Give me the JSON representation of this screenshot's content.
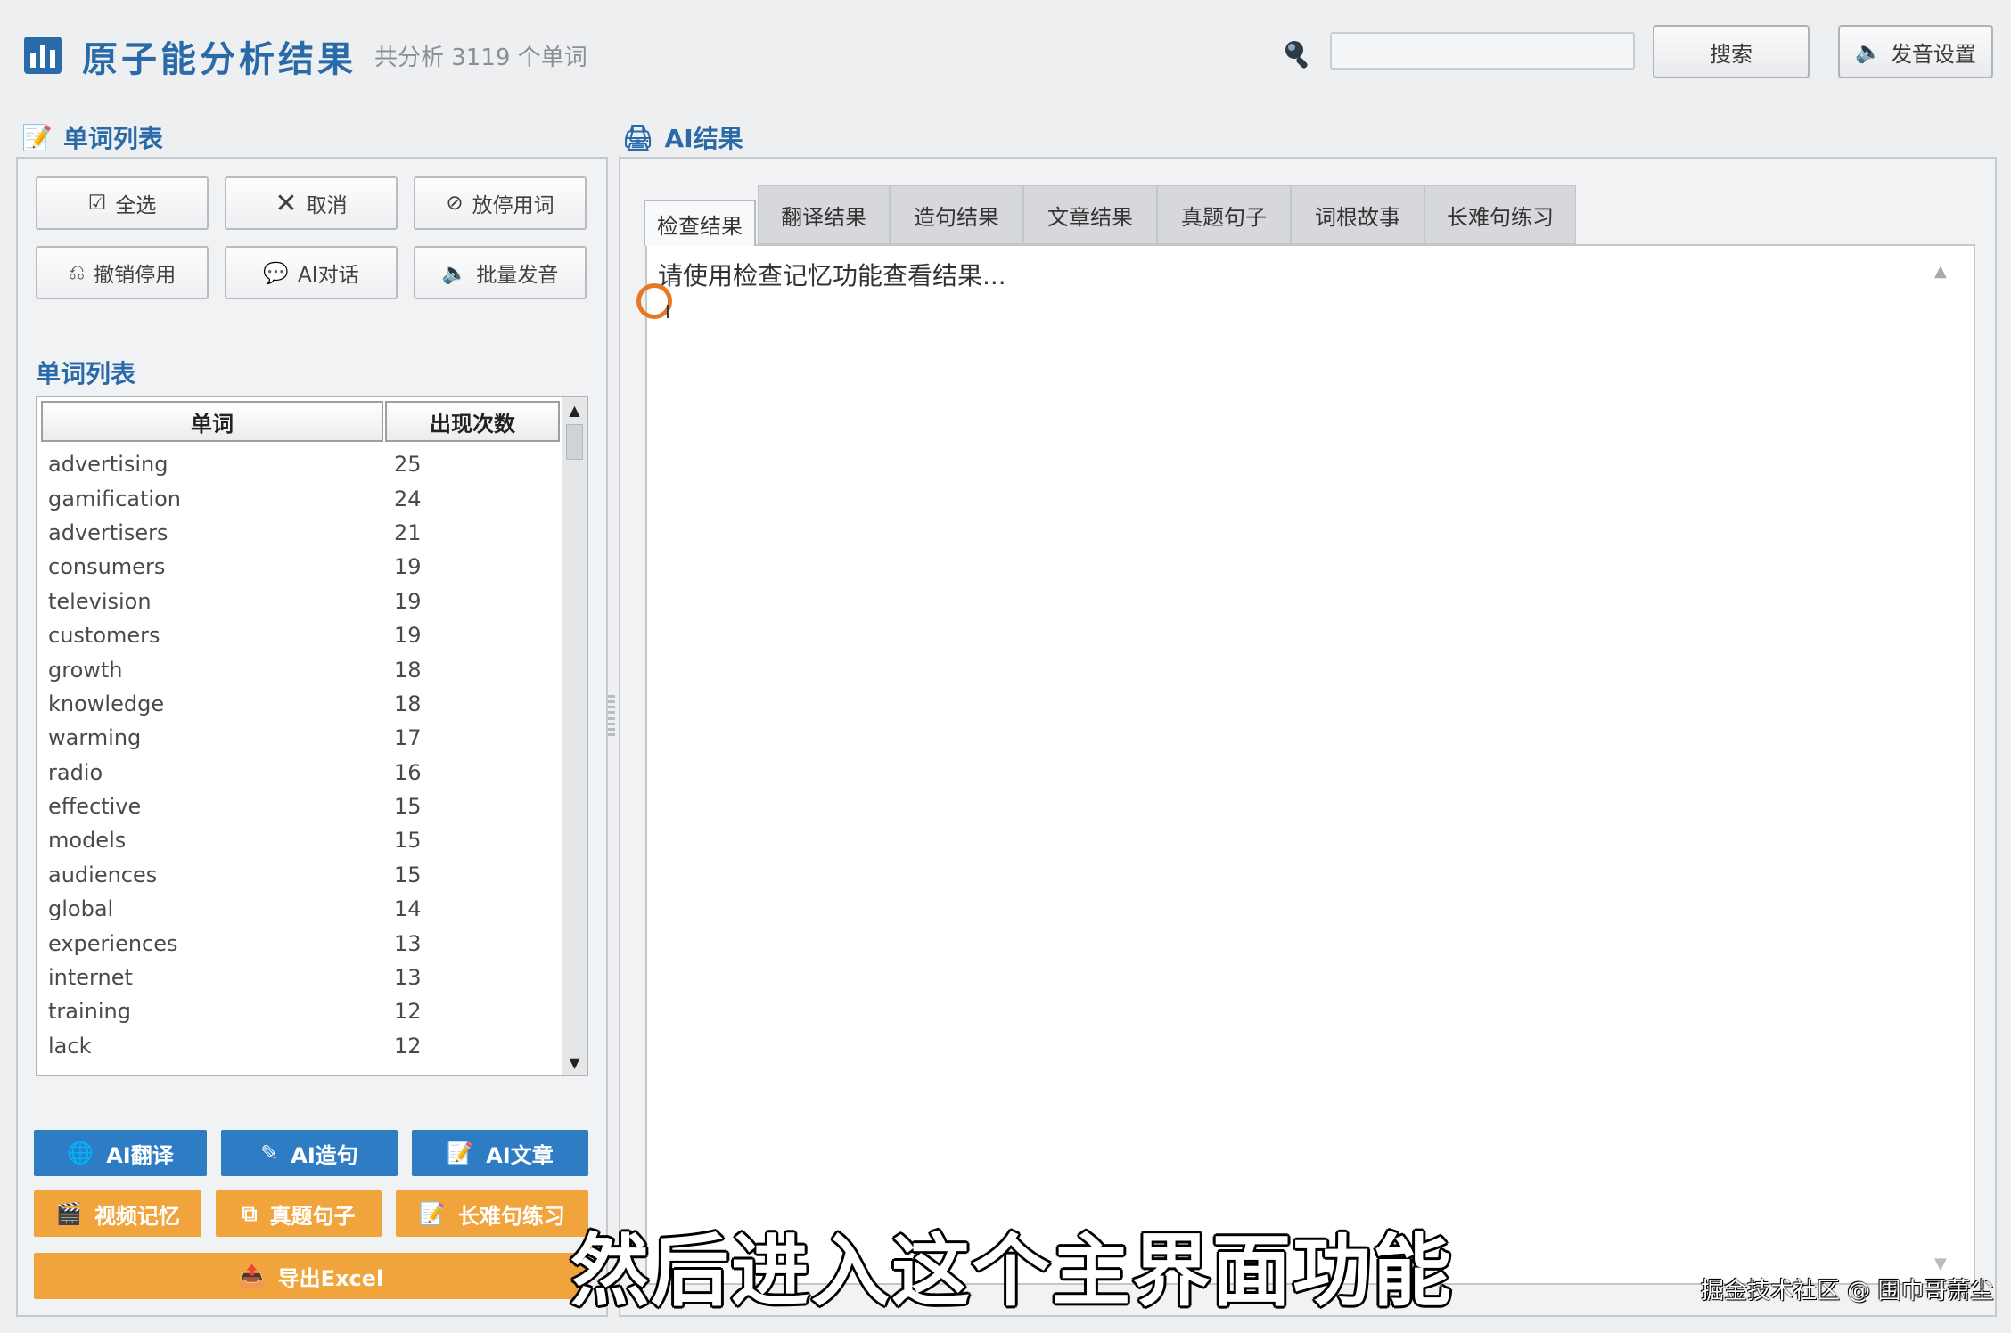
{
  "header": {
    "title": "原子能分析结果",
    "subtitle": "共分析 3119 个单词",
    "search_placeholder": "",
    "search_button": "搜索",
    "voice_button": "发音设置"
  },
  "left": {
    "section_title": "单词列表",
    "buttons": {
      "select_all": "全选",
      "cancel": "取消",
      "disable_word": "放停用词",
      "undo_disable": "撤销停用",
      "ai_chat": "AI对话",
      "batch_pronounce": "批量发音"
    },
    "list_caption": "单词列表",
    "table": {
      "col_word": "单词",
      "col_count": "出现次数",
      "rows": [
        {
          "word": "advertising",
          "count": "25"
        },
        {
          "word": "gamification",
          "count": "24"
        },
        {
          "word": "advertisers",
          "count": "21"
        },
        {
          "word": "consumers",
          "count": "19"
        },
        {
          "word": "television",
          "count": "19"
        },
        {
          "word": "customers",
          "count": "19"
        },
        {
          "word": "growth",
          "count": "18"
        },
        {
          "word": "knowledge",
          "count": "18"
        },
        {
          "word": "warming",
          "count": "17"
        },
        {
          "word": "radio",
          "count": "16"
        },
        {
          "word": "effective",
          "count": "15"
        },
        {
          "word": "models",
          "count": "15"
        },
        {
          "word": "audiences",
          "count": "15"
        },
        {
          "word": "global",
          "count": "14"
        },
        {
          "word": "experiences",
          "count": "13"
        },
        {
          "word": "internet",
          "count": "13"
        },
        {
          "word": "training",
          "count": "12"
        },
        {
          "word": "lack",
          "count": "12"
        }
      ]
    },
    "actions": {
      "ai_translate": "AI翻译",
      "ai_sentence": "AI造句",
      "ai_article": "AI文章",
      "video_memory": "视频记忆",
      "exam_sentence": "真题句子",
      "long_sentence": "长难句练习",
      "export_excel": "导出Excel"
    }
  },
  "right": {
    "section_title": "AI结果",
    "tabs": [
      "检查结果",
      "翻译结果",
      "造句结果",
      "文章结果",
      "真题句子",
      "词根故事",
      "长难句练习"
    ],
    "content_text": "请使用检查记忆功能查看结果..."
  },
  "overlay": {
    "subtitle": "然后进入这个主界面功能",
    "watermark": "掘金技术社区 @ 围巾哥萧尘"
  },
  "colors": {
    "accent_blue": "#2e7cc4",
    "accent_orange": "#f0a43b",
    "title_blue": "#2a6aa8"
  }
}
